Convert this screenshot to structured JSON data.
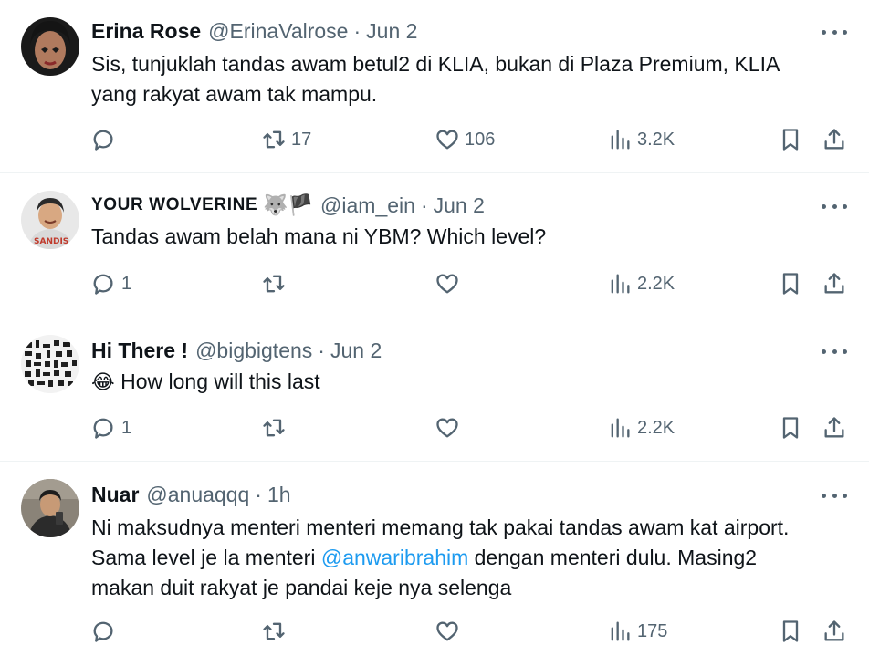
{
  "tweets": [
    {
      "name": "Erina Rose",
      "name_emoji": "",
      "handle": "@ErinaValrose",
      "separator": "·",
      "time": "Jun 2",
      "body_lines": [
        "Sis, tunjuklah tandas awam betul2 di KLIA, bukan di Plaza Premium, KLIA",
        "yang rakyat awam tak mampu."
      ],
      "replies": "",
      "retweets": "17",
      "likes": "106",
      "views": "3.2K"
    },
    {
      "name": "YOUR WOLVERINE",
      "name_emoji": "🐺🏴",
      "handle": "@iam_ein",
      "separator": "·",
      "time": "Jun 2",
      "body_lines": [
        "Tandas awam belah mana ni YBM? Which level?"
      ],
      "replies": "1",
      "retweets": "",
      "likes": "",
      "views": "2.2K"
    },
    {
      "name": "Hi There !",
      "name_emoji": "",
      "handle": "@bigbigtens",
      "separator": "·",
      "time": "Jun 2",
      "body_emoji": "😂",
      "body_text": "How long will this last",
      "replies": "1",
      "retweets": "",
      "likes": "",
      "views": "2.2K"
    },
    {
      "name": "Nuar",
      "name_emoji": "",
      "handle": "@anuaqqq",
      "separator": "·",
      "time": "1h",
      "body_line1": "Ni maksudnya menteri menteri memang tak pakai tandas awam kat airport.",
      "body_line2_before": "Sama level je la menteri ",
      "body_mention": "@anwaribrahim",
      "body_line2_after": " dengan menteri dulu. Masing2",
      "body_line3": "makan duit rakyat je pandai keje nya selenga",
      "replies": "",
      "retweets": "",
      "likes": "",
      "views": "175"
    }
  ],
  "colors": {
    "text": "#0f1419",
    "secondary": "#536471",
    "mention": "#1d9bf0",
    "divider": "#eff3f4"
  },
  "icons": [
    "reply-icon",
    "retweet-icon",
    "like-icon",
    "views-icon",
    "bookmark-icon",
    "share-icon",
    "more-icon"
  ]
}
